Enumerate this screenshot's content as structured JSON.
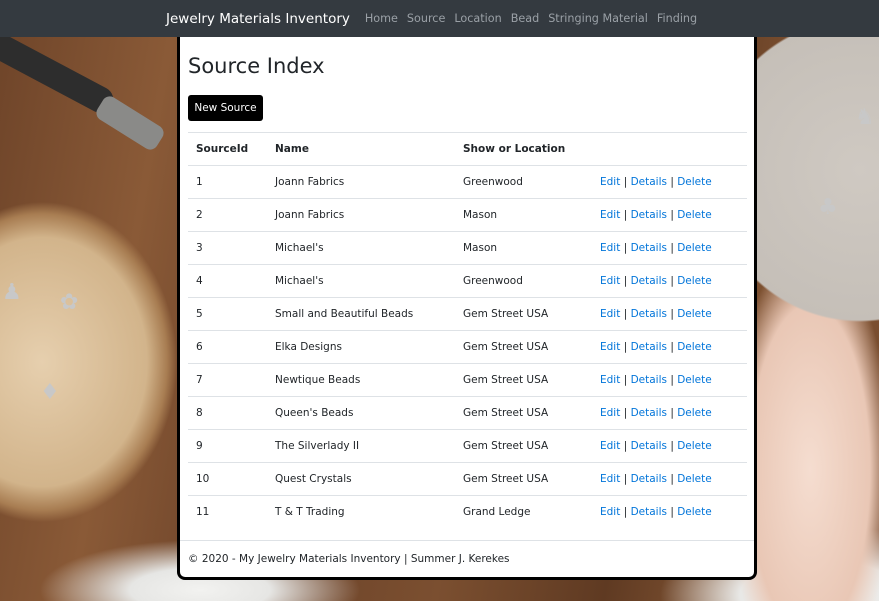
{
  "navbar": {
    "brand": "Jewelry Materials Inventory",
    "links": [
      "Home",
      "Source",
      "Location",
      "Bead",
      "Stringing Material",
      "Finding"
    ]
  },
  "page": {
    "title": "Source Index",
    "new_button": "New Source"
  },
  "table": {
    "headers": [
      "SourceId",
      "Name",
      "Show or Location"
    ],
    "action_labels": {
      "edit": "Edit",
      "details": "Details",
      "delete": "Delete",
      "separator": "|"
    },
    "rows": [
      {
        "id": "1",
        "name": "Joann Fabrics",
        "location": "Greenwood"
      },
      {
        "id": "2",
        "name": "Joann Fabrics",
        "location": "Mason"
      },
      {
        "id": "3",
        "name": "Michael's",
        "location": "Mason"
      },
      {
        "id": "4",
        "name": "Michael's",
        "location": "Greenwood"
      },
      {
        "id": "5",
        "name": "Small and Beautiful Beads",
        "location": "Gem Street USA"
      },
      {
        "id": "6",
        "name": "Elka Designs",
        "location": "Gem Street USA"
      },
      {
        "id": "7",
        "name": "Newtique Beads",
        "location": "Gem Street USA"
      },
      {
        "id": "8",
        "name": "Queen's Beads",
        "location": "Gem Street USA"
      },
      {
        "id": "9",
        "name": "The Silverlady II",
        "location": "Gem Street USA"
      },
      {
        "id": "10",
        "name": "Quest Crystals",
        "location": "Gem Street USA"
      },
      {
        "id": "11",
        "name": "T & T Trading",
        "location": "Grand Ledge"
      }
    ]
  },
  "footer": {
    "text": "© 2020 - My Jewelry Materials Inventory | Summer J. Kerekes"
  },
  "colors": {
    "navbar": "#343a40",
    "link": "#0074d9",
    "button": "#000000"
  }
}
